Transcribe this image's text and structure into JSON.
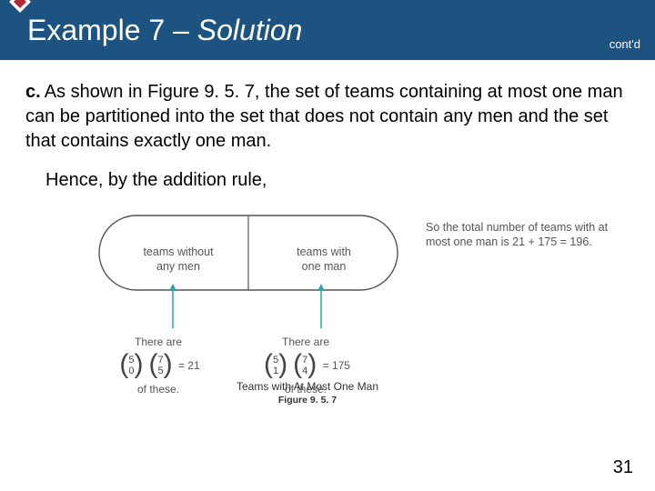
{
  "header": {
    "title_plain": "Example 7 – ",
    "title_italic": "Solution",
    "contd": "cont'd",
    "icon_name": "diamond-bullet"
  },
  "body": {
    "item_label": "c.",
    "para1": "As shown in Figure 9. 5. 7, the set of teams containing at most one man can be partitioned into the set that does not contain any men and the set that contains exactly one man.",
    "hence": "Hence, by the addition rule,"
  },
  "figure": {
    "left_cell_line1": "teams without",
    "left_cell_line2": "any men",
    "right_cell_line1": "teams with",
    "right_cell_line2": "one man",
    "side_note": "So the total number of teams with at most one man is 21 + 175 = 196.",
    "below_intro": "There are",
    "below_outro": "of these.",
    "left_binom_top1": "5",
    "left_binom_bot1": "0",
    "left_binom_top2": "7",
    "left_binom_bot2": "5",
    "left_result": " = 21",
    "right_binom_top1": "5",
    "right_binom_bot1": "1",
    "right_binom_top2": "7",
    "right_binom_bot2": "4",
    "right_result": " = 175",
    "caption_line1": "Teams with At Most One Man",
    "caption_line2": "Figure 9. 5. 7"
  },
  "page_number": "31"
}
